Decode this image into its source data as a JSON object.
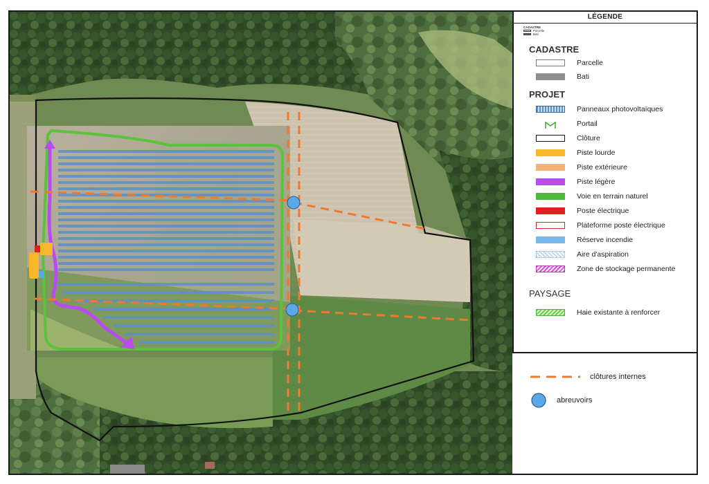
{
  "legend": {
    "header": "LÉGENDE",
    "mini_inset": {
      "title": "CADASTRE",
      "items": [
        "Parcelle",
        "Bati"
      ]
    },
    "sections": [
      {
        "title": "CADASTRE",
        "items": [
          {
            "label": "Parcelle",
            "swatch": "outline-gray"
          },
          {
            "label": "Bati",
            "swatch": "fill-gray"
          }
        ]
      },
      {
        "title": "PROJET",
        "items": [
          {
            "label": "Panneaux photovoltaïques",
            "swatch": "pv-panels"
          },
          {
            "label": "Portail",
            "swatch": "gate-icon"
          },
          {
            "label": "Clôture",
            "swatch": "outline-black"
          },
          {
            "label": "Piste lourde",
            "swatch": "fill-yellow"
          },
          {
            "label": "Piste extérieure",
            "swatch": "fill-tan"
          },
          {
            "label": "Piste légère",
            "swatch": "fill-purple"
          },
          {
            "label": "Voie en terrain naturel",
            "swatch": "fill-green"
          },
          {
            "label": "Poste électrique",
            "swatch": "fill-red"
          },
          {
            "label": "Plateforme poste électrique",
            "swatch": "outline-red"
          },
          {
            "label": "Réserve incendie",
            "swatch": "fill-lightblue"
          },
          {
            "label": "Aire d'aspiration",
            "swatch": "hatch-blue"
          },
          {
            "label": "Zone de stockage permanente",
            "swatch": "hatch-magenta"
          }
        ]
      },
      {
        "title": "PAYSAGE",
        "items": [
          {
            "label": "Haie existante à renforcer",
            "swatch": "hatch-green"
          }
        ]
      }
    ],
    "extra": [
      {
        "label": "clôtures internes",
        "symbol": "dashed-orange-line"
      },
      {
        "label": "abreuvoirs",
        "symbol": "blue-circle"
      }
    ]
  },
  "colors": {
    "purple_track": "#b84cf0",
    "green_track": "#5cc23c",
    "orange_dash": "#ee7a30",
    "trough_blue": "#5aa8e8",
    "fence_black": "#111111",
    "pv_blue": "#5a8fc8",
    "yellow": "#f6b82a",
    "tan": "#f2b47a",
    "red": "#e02020"
  }
}
